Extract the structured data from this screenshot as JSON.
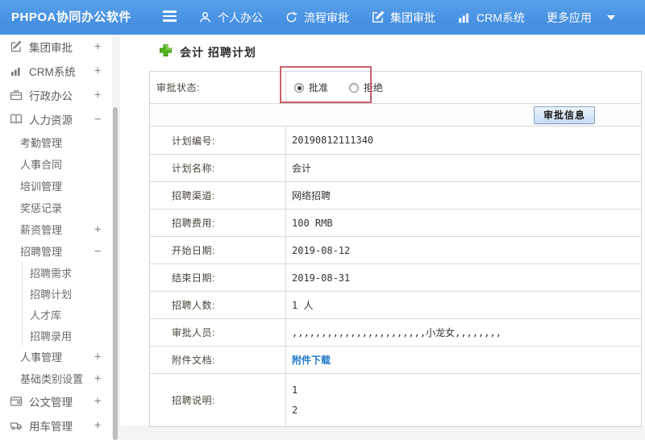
{
  "topbar": {
    "logo": "PHPOA协同办公软件",
    "nav": [
      {
        "label": "个人办公",
        "icon": "user-icon"
      },
      {
        "label": "流程审批",
        "icon": "cycle-icon"
      },
      {
        "label": "集团审批",
        "icon": "edit-square-icon"
      },
      {
        "label": "CRM系统",
        "icon": "bar-chart-icon"
      },
      {
        "label": "更多应用",
        "icon": "caret-down-icon"
      }
    ]
  },
  "sidebar": {
    "items": [
      {
        "label": "集团审批",
        "level": 0,
        "icon": "edit-square-icon",
        "expand": "+"
      },
      {
        "label": "CRM系统",
        "level": 0,
        "icon": "bar-chart-icon",
        "expand": "+"
      },
      {
        "label": "行政办公",
        "level": 0,
        "icon": "briefcase-icon",
        "expand": "+"
      },
      {
        "label": "人力资源",
        "level": 0,
        "icon": "book-icon",
        "expand": "−"
      },
      {
        "label": "考勤管理",
        "level": 1
      },
      {
        "label": "人事合同",
        "level": 1
      },
      {
        "label": "培训管理",
        "level": 1
      },
      {
        "label": "奖惩记录",
        "level": 1
      },
      {
        "label": "薪资管理",
        "level": 1,
        "expand": "+"
      },
      {
        "label": "招聘管理",
        "level": 1,
        "expand": "−"
      },
      {
        "label": "招聘需求",
        "level": 2
      },
      {
        "label": "招聘计划",
        "level": 2
      },
      {
        "label": "人才库",
        "level": 2
      },
      {
        "label": "招聘录用",
        "level": 2
      },
      {
        "label": "人事管理",
        "level": 1,
        "expand": "+"
      },
      {
        "label": "基础类别设置",
        "level": 1,
        "expand": "+"
      },
      {
        "label": "公文管理",
        "level": 0,
        "icon": "document-icon",
        "expand": "+"
      },
      {
        "label": "用车管理",
        "level": 0,
        "icon": "car-icon",
        "expand": "+"
      }
    ]
  },
  "main": {
    "title": "会计 招聘计划",
    "approval": {
      "label": "审批状态:",
      "options": [
        {
          "label": "批准",
          "selected": true
        },
        {
          "label": "拒绝",
          "selected": false
        }
      ],
      "button": "审批信息"
    },
    "form": {
      "rows": [
        {
          "label": "计划编号:",
          "value": "20190812111340"
        },
        {
          "label": "计划名称:",
          "value": "会计"
        },
        {
          "label": "招聘渠道:",
          "value": "网络招聘"
        },
        {
          "label": "招聘费用:",
          "value": "100 RMB"
        },
        {
          "label": "开始日期:",
          "value": "2019-08-12"
        },
        {
          "label": "结束日期:",
          "value": "2019-08-31"
        },
        {
          "label": "招聘人数:",
          "value": "1 人"
        },
        {
          "label": "审批人员:",
          "value": ",,,,,,,,,,,,,,,,,,,,,,,小龙女,,,,,,,,"
        },
        {
          "label": "附件文档:",
          "value": "附件下载"
        },
        {
          "label": "招聘说明:",
          "value1": "1",
          "value2": "2"
        }
      ]
    }
  },
  "colors": {
    "topbar_blue": "#4891e2",
    "highlight_red": "#c5606a",
    "link_blue": "#2077c8",
    "button_border_blue": "#85a3c4",
    "plus_green": "#54b41d"
  }
}
